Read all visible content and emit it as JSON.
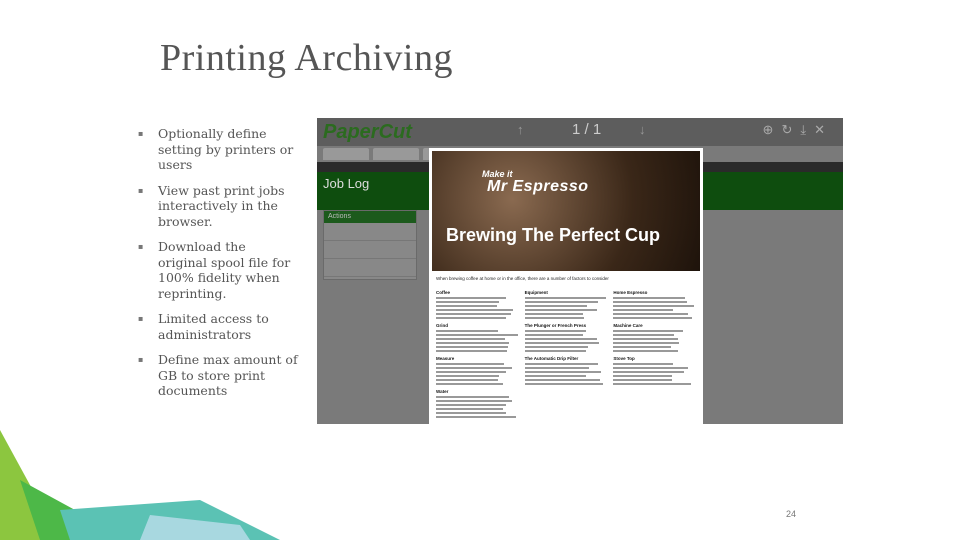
{
  "slide": {
    "title": "Printing Archiving",
    "page_number": "24",
    "bullets": [
      "Optionally define setting by printers or users",
      "View past print jobs interactively in the browser.",
      "Download the original spool file for 100% fidelity when reprinting.",
      "Limited access to administrators",
      "Define max amount of GB to store print documents"
    ]
  },
  "screenshot": {
    "logo": "PaperCut",
    "pager": "1 / 1",
    "page_title": "Job Log",
    "actions_header": "Actions",
    "document": {
      "make_it": "Make it",
      "brand": "Mr Espresso",
      "headline": "Brewing The Perfect Cup",
      "intro": "When brewing coffee at home or in the office, there are a number of factors to consider",
      "columns": [
        [
          "Coffee",
          "Grind",
          "Measure",
          "Water"
        ],
        [
          "Equipment",
          "The Plunger or French Press",
          "The Automatic Drip Filter"
        ],
        [
          "Home Espresso",
          "Machine Care",
          "Stove Top"
        ]
      ]
    }
  },
  "colors": {
    "accent_green": "#0e4d0e",
    "deco_greens": [
      "#8cc63f",
      "#4db848",
      "#5bc2b4"
    ]
  }
}
